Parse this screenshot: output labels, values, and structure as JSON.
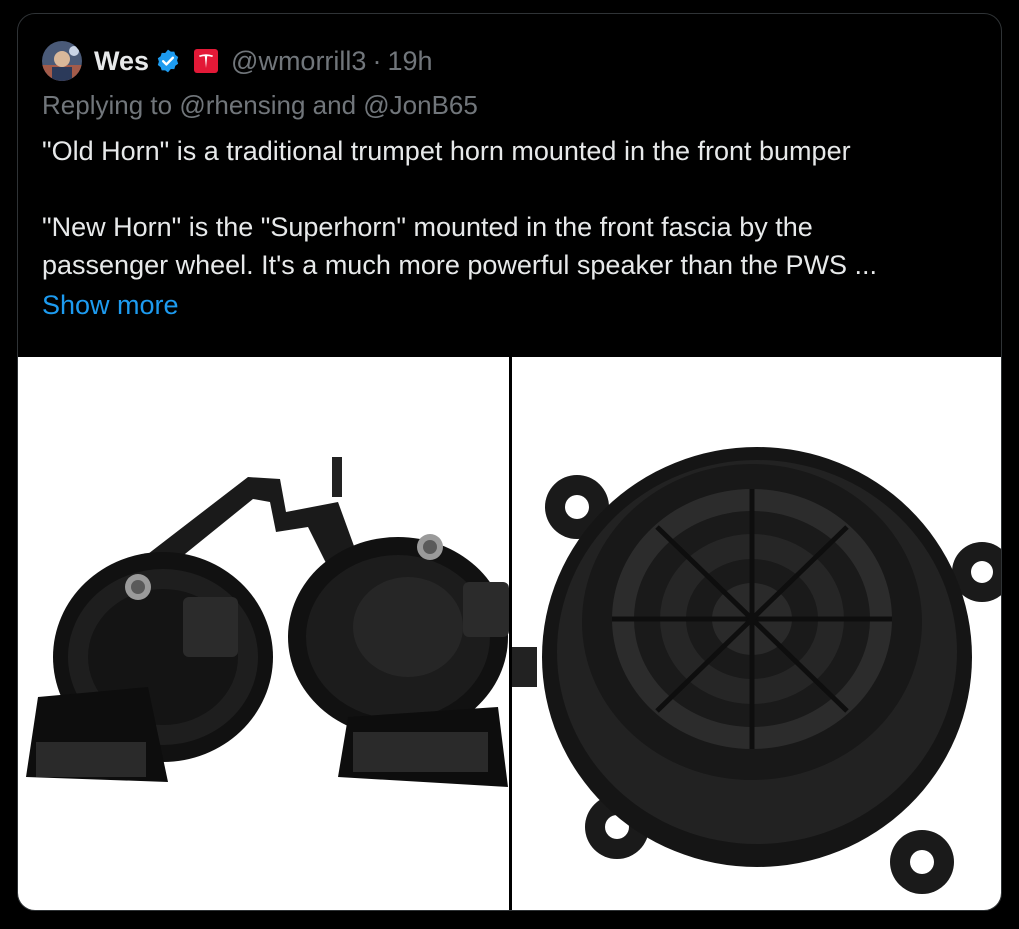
{
  "tweet": {
    "author_name": "Wes",
    "author_handle": "@wmorrill3",
    "separator": "·",
    "timestamp": "19h",
    "replying_prefix": "Replying to ",
    "reply_mention_1": "@rhensing",
    "reply_conjunction": " and ",
    "reply_mention_2": "@JonB65",
    "body_line_1": "\"Old Horn\" is a traditional trumpet horn mounted in the front bumper",
    "body_line_2": "\"New Horn\" is the \"Superhorn\" mounted in the front fascia by the",
    "body_line_3": "passenger wheel. It's a much more powerful speaker than the PWS ...",
    "show_more": "Show more"
  },
  "icons": {
    "verified": "verified-badge-icon",
    "affiliation": "tesla-logo-icon"
  },
  "colors": {
    "background": "#000000",
    "text_primary": "#e7e9ea",
    "text_secondary": "#71767b",
    "link": "#1d9bf0",
    "verified": "#1d9bf0",
    "affiliation_bg": "#e31937"
  },
  "media": [
    {
      "alt": "old-horn-photo"
    },
    {
      "alt": "superhorn-speaker-photo"
    }
  ]
}
